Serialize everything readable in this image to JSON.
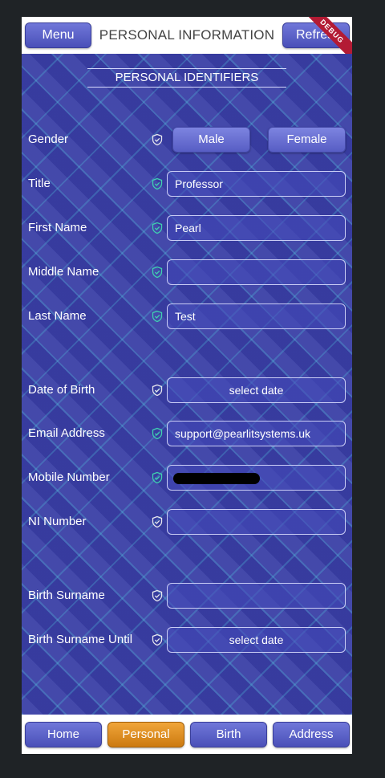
{
  "header": {
    "menu_label": "Menu",
    "title": "PERSONAL INFORMATION",
    "refresh_label": "Refresh",
    "debug_badge": "DEBUG"
  },
  "section": {
    "title": "PERSONAL IDENTIFIERS"
  },
  "fields": {
    "gender": {
      "label": "Gender",
      "options": [
        "Male",
        "Female"
      ]
    },
    "title": {
      "label": "Title",
      "value": "Professor"
    },
    "first_name": {
      "label": "First Name",
      "value": "Pearl"
    },
    "middle_name": {
      "label": "Middle Name",
      "value": ""
    },
    "last_name": {
      "label": "Last Name",
      "value": "Test"
    },
    "date_of_birth": {
      "label": "Date of Birth",
      "button": "select date"
    },
    "email": {
      "label": "Email Address",
      "value": "support@pearlitsystems.uk"
    },
    "mobile": {
      "label": "Mobile Number",
      "value": ""
    },
    "ni_number": {
      "label": "NI Number",
      "value": ""
    },
    "birth_surname": {
      "label": "Birth Surname",
      "value": ""
    },
    "birth_surname_until": {
      "label": "Birth Surname Until",
      "button": "select date"
    }
  },
  "nav": {
    "items": [
      "Home",
      "Personal",
      "Birth",
      "Address"
    ],
    "active": "Personal"
  },
  "colors": {
    "background": "#3a3fa6",
    "button": "#5a60c8",
    "active_tab": "#e39322",
    "shield_gray": "#e6e6ee",
    "shield_teal": "#3fd0b0",
    "debug_ribbon": "#b31b34"
  }
}
